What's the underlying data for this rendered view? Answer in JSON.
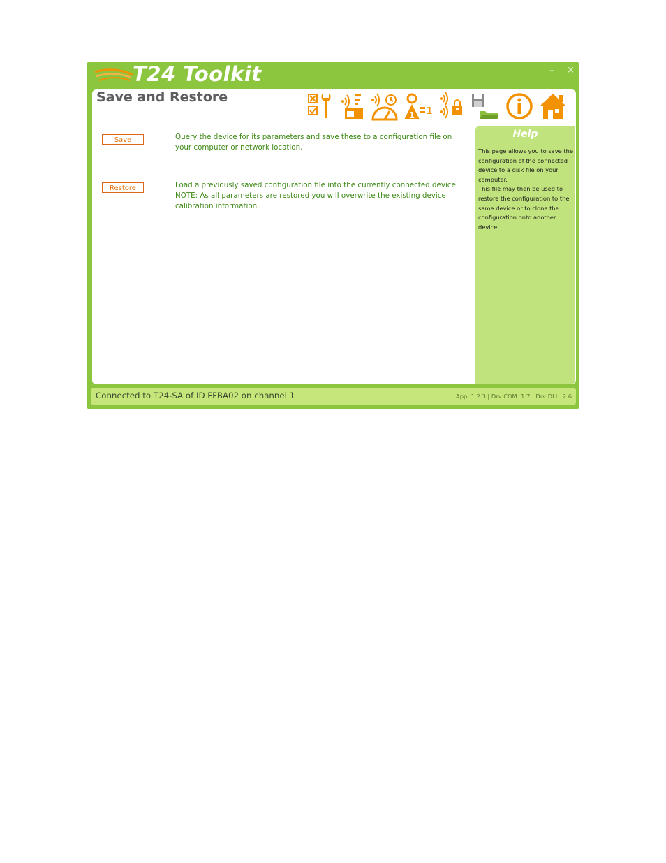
{
  "window": {
    "title": "T24 Toolkit",
    "minimize_glyph": "–",
    "close_glyph": "×"
  },
  "page": {
    "title": "Save and Restore"
  },
  "toolbar": {
    "icons": [
      "configure-wrench-icon",
      "radio-module-icon",
      "timing-dial-icon",
      "sensor-identify-icon",
      "radio-lock-icon",
      "save-restore-icon",
      "info-icon",
      "home-icon"
    ]
  },
  "actions": {
    "save": {
      "label": "Save",
      "description": "Query the device for its parameters and save these to a configuration file on your computer or network location."
    },
    "restore": {
      "label": "Restore",
      "description_line1": "Load a previously saved configuration file into the currently connected device.",
      "description_line2": "NOTE: As all parameters are restored you will overwrite the existing device calibration information."
    }
  },
  "help": {
    "title": "Help",
    "paragraph1": "This page allows you to save the configuration of the connected device to a disk file on your computer.",
    "paragraph2": "This file may then be used to restore the configuration to the same device or to clone the configuration onto another device."
  },
  "status": {
    "connection": "Connected to T24-SA of ID FFBA02 on channel 1",
    "versions": "App: 1.2.3 | Drv COM: 1.7 | Drv DLL: 2.6"
  },
  "colors": {
    "frame_green": "#8cc63f",
    "help_green": "#c1e37d",
    "accent_orange": "#f39200",
    "text_green": "#3f8a18"
  }
}
